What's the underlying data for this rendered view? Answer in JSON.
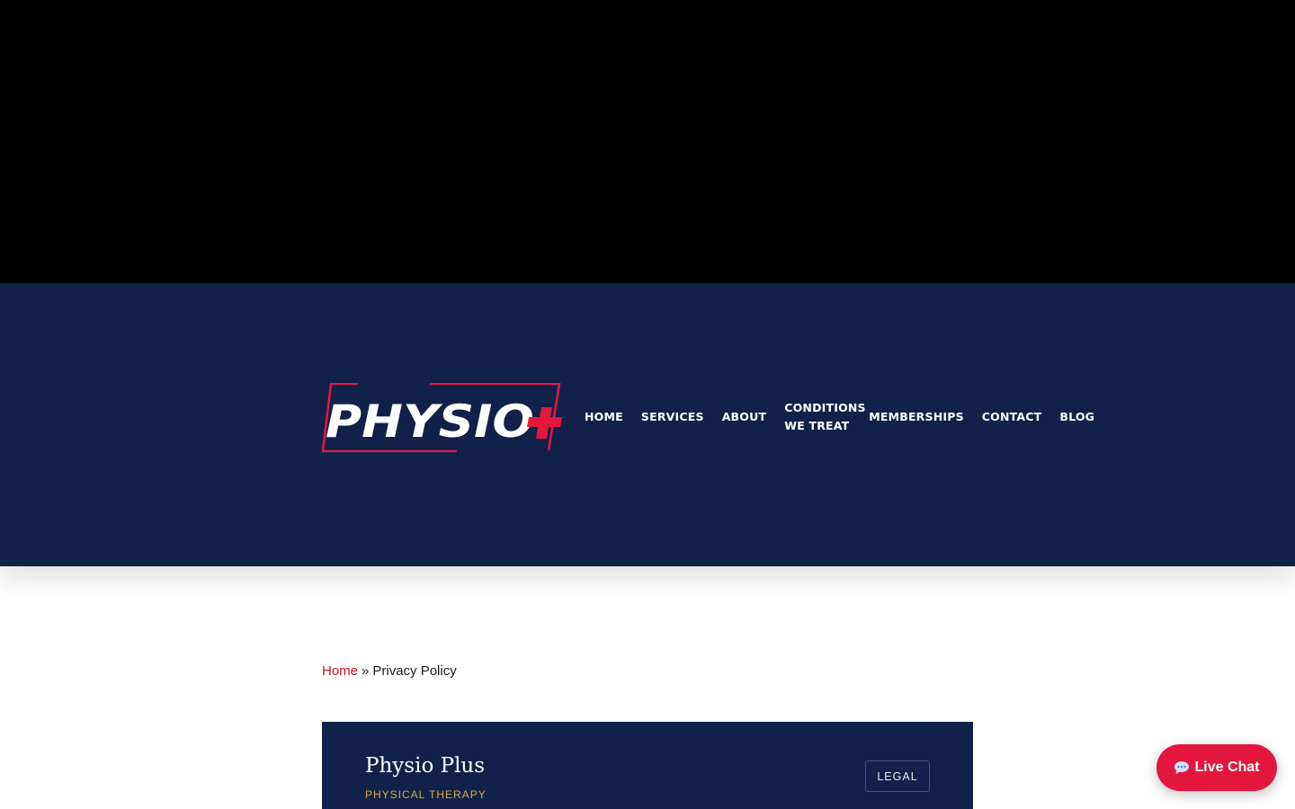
{
  "brand": {
    "logo_text": "PHYSIO",
    "logo_symbol": "+",
    "colors": {
      "navy": "#12214a",
      "red": "#e3173e",
      "gold": "#d8a844"
    }
  },
  "nav": {
    "home": "HOME",
    "services": "SERVICES",
    "about": "ABOUT",
    "conditions": "CONDITIONS WE TREAT",
    "memberships": "MEMBERSHIPS",
    "contact": "CONTACT",
    "blog": "BLOG"
  },
  "breadcrumb": {
    "home": "Home",
    "separator": "»",
    "current": "Privacy Policy"
  },
  "card": {
    "title": "Physio Plus",
    "subtitle": "PHYSICAL THERAPY",
    "badge": "LEGAL"
  },
  "chat": {
    "icon": "chat-bubble-icon",
    "label": "Live Chat"
  }
}
